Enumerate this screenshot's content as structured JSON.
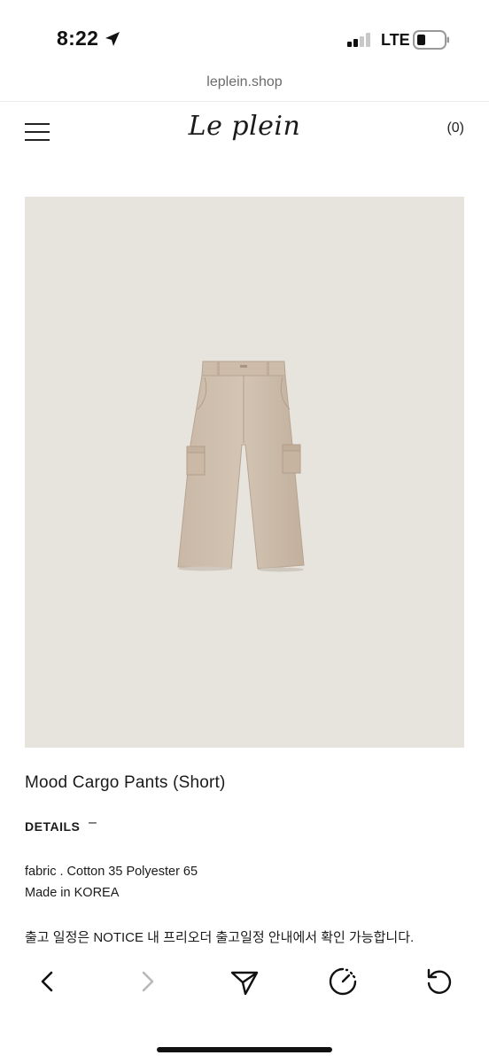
{
  "status_bar": {
    "time": "8:22",
    "network": "LTE",
    "icons": [
      "location-arrow-icon",
      "signal-bars-icon",
      "battery-icon"
    ]
  },
  "browser": {
    "url": "leplein.shop",
    "toolbar_icons": [
      "back-chevron-icon",
      "forward-chevron-icon",
      "share-send-icon",
      "speed-gauge-icon",
      "reload-icon"
    ]
  },
  "header": {
    "logo": "Le plein",
    "cart_count": "(0)"
  },
  "product": {
    "image_bg": "#e7e3dd",
    "title": "Mood Cargo Pants (Short)",
    "details_heading": "DETAILS",
    "details_toggle": "–",
    "fabric": "fabric . Cotton 35 Polyester 65",
    "origin": "Made in KOREA",
    "notice": "출고 일정은 NOTICE 내 프리오더 출고일정 안내에서 확인 가능합니다."
  }
}
